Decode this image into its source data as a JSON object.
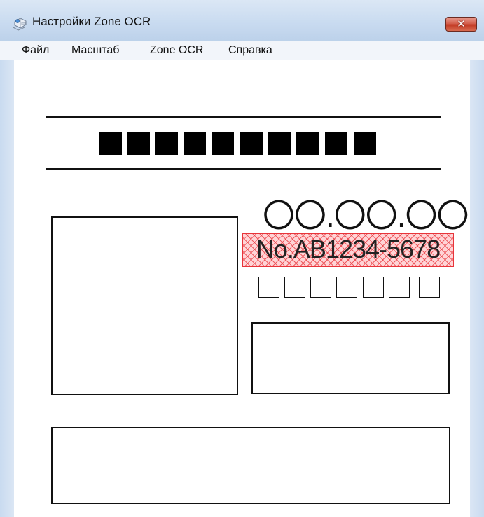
{
  "window": {
    "title": "Настройки Zone OCR",
    "icon": "app-scanner-icon",
    "close_label": "✕"
  },
  "menu": [
    {
      "label": "Файл"
    },
    {
      "label": "Масштаб"
    },
    {
      "label": "Zone OCR"
    },
    {
      "label": "Справка"
    }
  ],
  "document": {
    "date_placeholder": "〇〇.〇〇.〇〇",
    "doc_number": "No.AB1234-5678",
    "title_blocks": "10 black squares",
    "number_boxes": "7 empty boxes",
    "highlight_color": "#e8343a"
  }
}
